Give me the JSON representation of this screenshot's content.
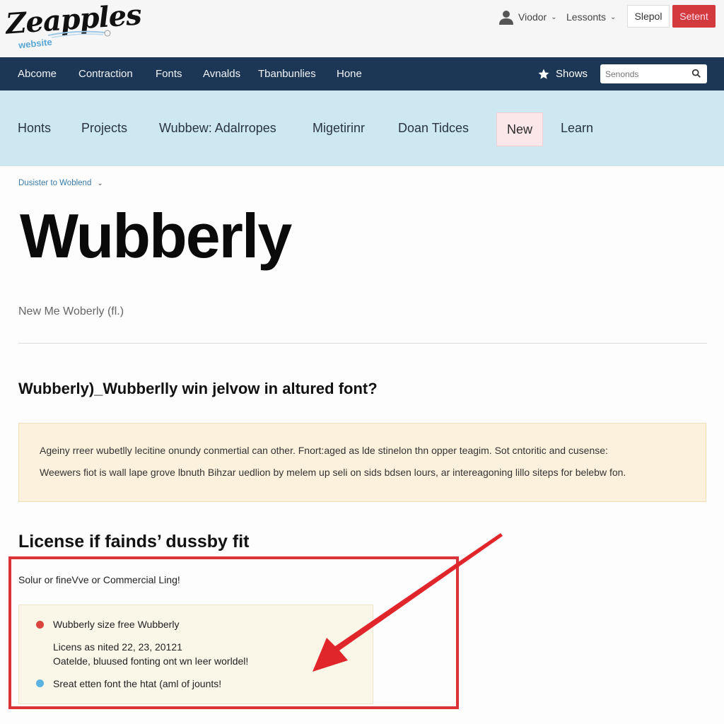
{
  "header": {
    "logo_text": "Zeapples",
    "logo_subtext": "website",
    "user_menu_label": "Viodor",
    "lessons_menu_label": "Lessonts",
    "secondary_button_label": "Slepol",
    "primary_button_label": "Setent"
  },
  "navbar": {
    "items": [
      {
        "label": "Abcome"
      },
      {
        "label": "Contraction"
      },
      {
        "label": "Fonts"
      },
      {
        "label": "Avnalds"
      },
      {
        "label": "Tbanbunlies"
      },
      {
        "label": "Hone"
      }
    ],
    "shows_label": "Shows",
    "search_placeholder": "Senonds"
  },
  "subnav": {
    "items": [
      {
        "label": "Honts"
      },
      {
        "label": "Projects"
      },
      {
        "label": "Wubbew: Adalrropes"
      },
      {
        "label": "Migetirinr"
      },
      {
        "label": "Doan Tidces"
      },
      {
        "label": "New"
      },
      {
        "label": "Learn"
      }
    ],
    "active_item": "New"
  },
  "main": {
    "breadcrumb": "Dusister to Woblend",
    "title": "Wubberly",
    "subtitle": "New Me Woberly (fl.)",
    "question": "Wubberly)_Wubberlly win jelvow in altured font?",
    "note_lines": [
      "Ageiny rreer wubetlly lecitine onundy conmertial can other. Fnort:aged as lde stinelon thn opper teagim. Sot cntoritic and cusense:",
      "Weewers fiot is wall lape grove lbnuth Bihzar uedlion by melem up seli on sids bdsen lours, ar intereagoning lillo siteps for belebw fon."
    ],
    "license_title": "License if fainds’ dussby fit",
    "license_intro": "Solur or fineVve or Commercial Ling!",
    "license_card": {
      "item1": "Wubberly size free Wubberly",
      "line2": "Licens as nited 22, 23, 20121",
      "line3": "Oatelde, bluused fonting ont wn leer worldel!",
      "item4": "Sreat etten font the htat (aml of jounts!"
    }
  },
  "colors": {
    "navbar_bg": "#1c3655",
    "subnav_bg": "#cde8f1",
    "primary_button": "#d33a3e",
    "annotation_red": "#e0262b",
    "note_bg": "#fcf1dc"
  }
}
